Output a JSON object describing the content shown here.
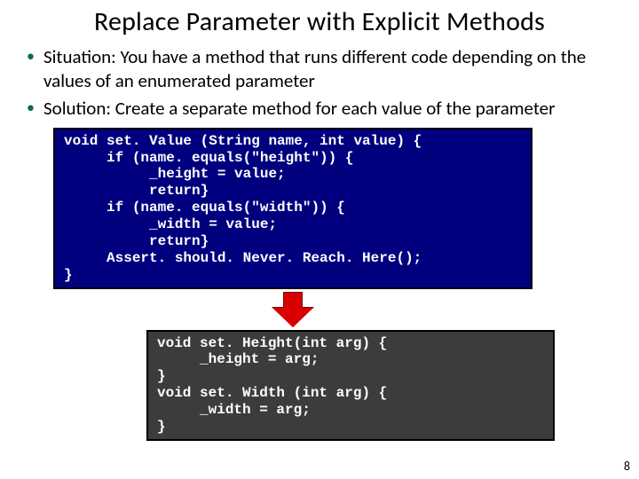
{
  "title": "Replace Parameter with Explicit Methods",
  "bullets": [
    {
      "label": "Situation:",
      "text": " You have a method that runs different code depending on the values of an enumerated parameter"
    },
    {
      "label": "Solution:",
      "text": " Create a separate method for each value of the parameter"
    }
  ],
  "code_before": "void set. Value (String name, int value) {\n     if (name. equals(\"height\")) {\n          _height = value;\n          return}\n     if (name. equals(\"width\")) {\n          _width = value;\n          return}\n     Assert. should. Never. Reach. Here();\n}",
  "code_after": "void set. Height(int arg) {\n     _height = arg;\n}\nvoid set. Width (int arg) {\n     _width = arg;\n}",
  "page_number": "8"
}
